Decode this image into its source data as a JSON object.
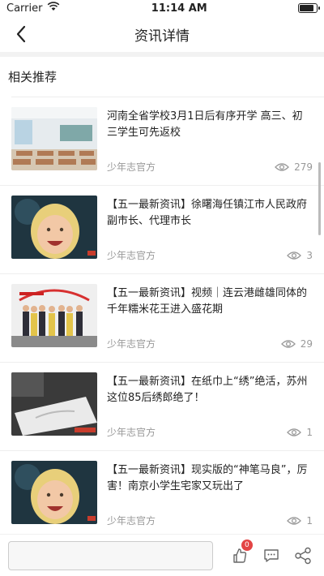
{
  "status_bar": {
    "carrier": "Carrier",
    "time": "11:14 AM",
    "battery_level": 0.9
  },
  "nav": {
    "title": "资讯详情"
  },
  "section": {
    "title": "相关推荐"
  },
  "items": [
    {
      "title": "河南全省学校3月1日后有序开学 高三、初三学生可先返校",
      "source": "少年志官方",
      "views": "279",
      "thumb": "classroom"
    },
    {
      "title": "【五一最新资讯】徐曙海任镇江市人民政府副市长、代理市长",
      "source": "少年志官方",
      "views": "3",
      "thumb": "child"
    },
    {
      "title": "【五一最新资讯】视频｜连云港雌雄同体的千年糯米花王进入盛花期",
      "source": "少年志官方",
      "views": "29",
      "thumb": "group"
    },
    {
      "title": "【五一最新资讯】在纸巾上“绣”绝活，苏州这位85后绣郎绝了！",
      "source": "少年志官方",
      "views": "1",
      "thumb": "embroidery"
    },
    {
      "title": "【五一最新资讯】现实版的“神笔马良”，厉害！南京小学生宅家又玩出了",
      "source": "少年志官方",
      "views": "1",
      "thumb": "child"
    }
  ],
  "bottom_bar": {
    "like_count": "0"
  },
  "colors": {
    "badge": "#e34444",
    "meta": "#999999"
  }
}
